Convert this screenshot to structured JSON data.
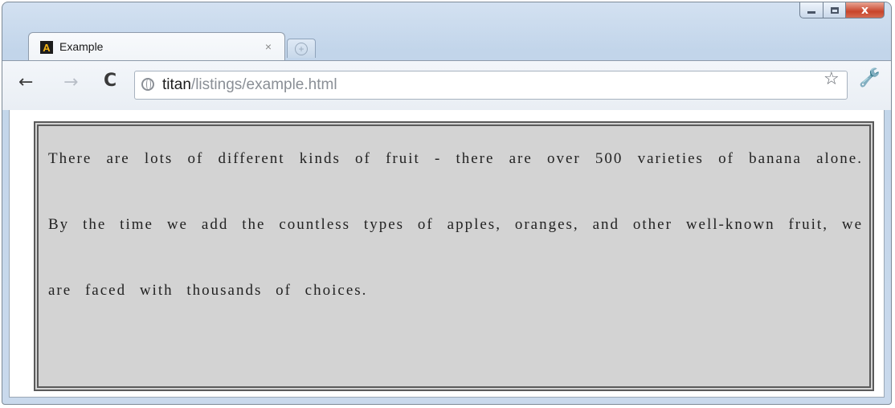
{
  "window": {
    "minimize_glyph": "",
    "maximize_glyph": "",
    "close_glyph": "x"
  },
  "tab": {
    "title": "Example",
    "favicon_glyph": "A",
    "close_glyph": "×",
    "newtab_glyph": "+"
  },
  "toolbar": {
    "back_glyph": "←",
    "forward_glyph": "→",
    "reload_glyph": "C",
    "url_host": "titan",
    "url_path": "/listings/example.html",
    "star_glyph": "☆",
    "wrench_glyph": "🔧"
  },
  "page": {
    "paragraph": "There are lots of different kinds of fruit - there are over 500 varieties of banana alone. By the time we add the countless types of apples, oranges, and other well-known fruit, we are faced with thousands of choices."
  },
  "colors": {
    "content_background": "#d3d3d3",
    "content_border": "#5a5a5a",
    "window_frame": "#c9d9ec",
    "close_button": "#c8442b"
  },
  "icons": [
    "favicon-icon",
    "close-tab-icon",
    "new-tab-icon",
    "back-arrow-icon",
    "forward-arrow-icon",
    "reload-icon",
    "globe-icon",
    "star-icon",
    "wrench-icon",
    "minimize-icon",
    "maximize-icon",
    "close-window-icon"
  ]
}
